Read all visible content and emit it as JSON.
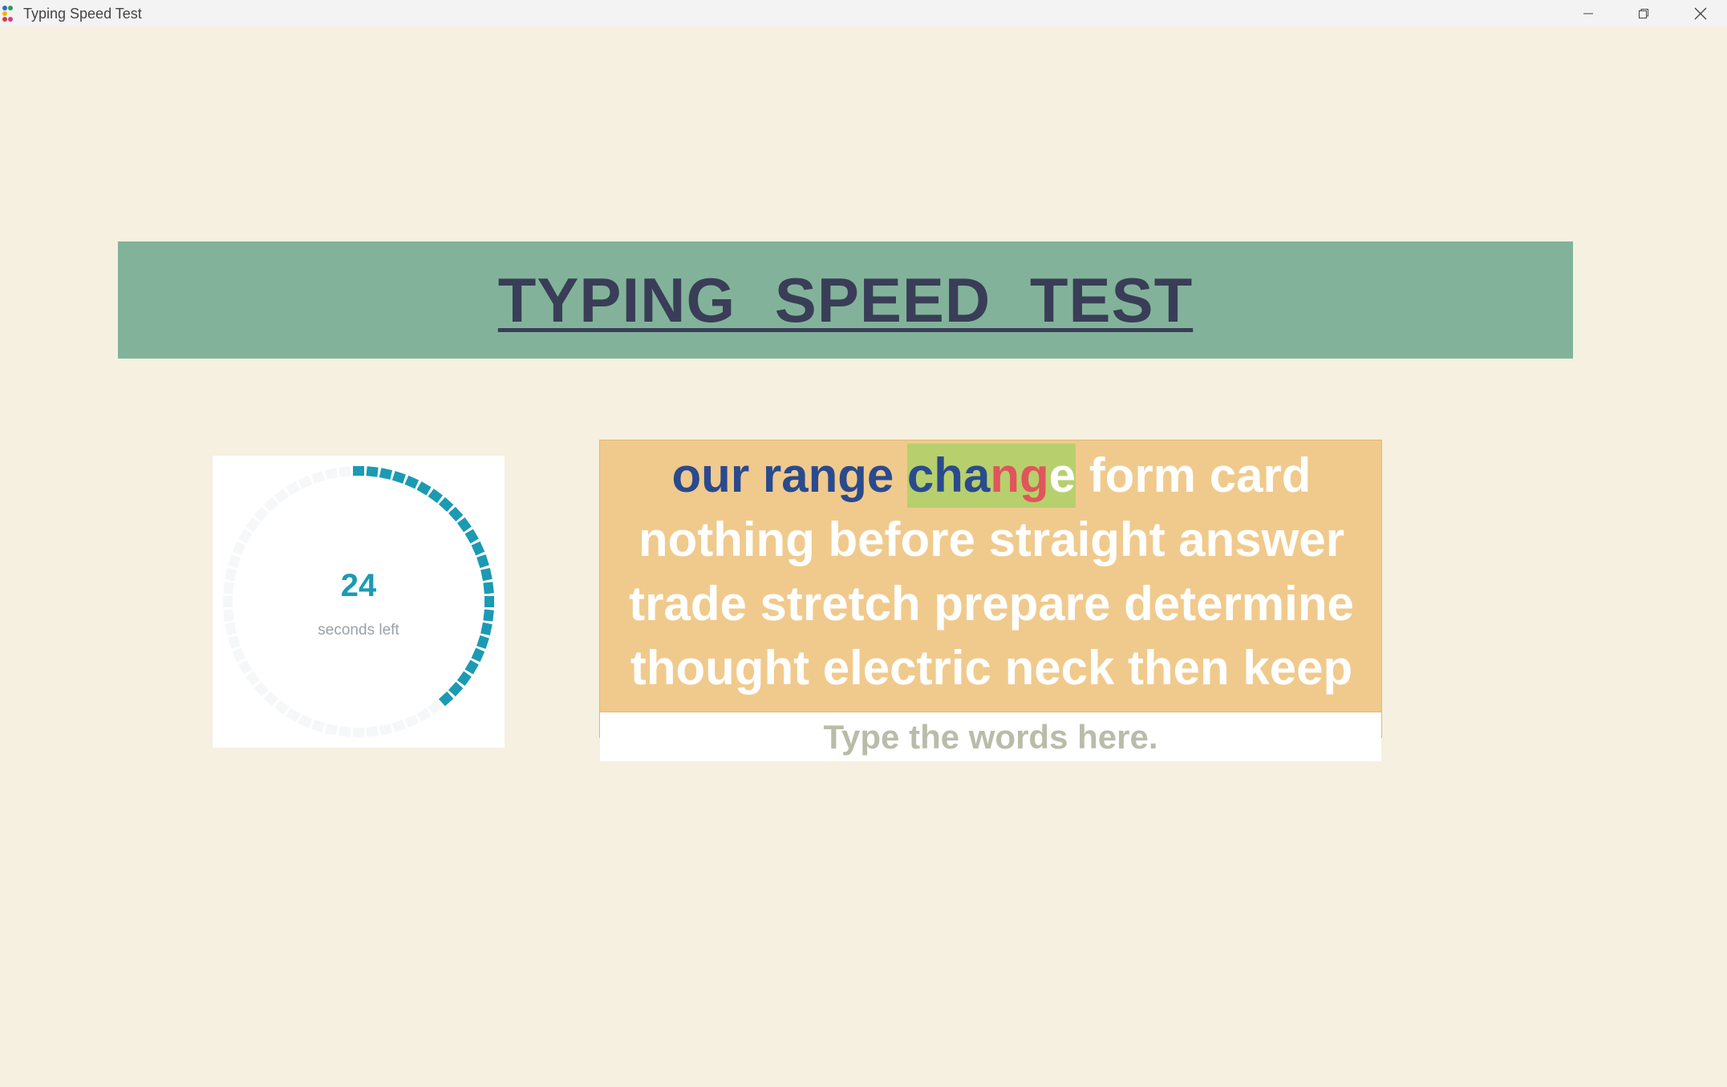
{
  "window": {
    "title": "Typing Speed Test",
    "minimize_icon": "minimize-icon",
    "maximize_icon": "restore-icon",
    "close_icon": "close-icon"
  },
  "banner": {
    "title": "TYPING  SPEED  TEST"
  },
  "timer": {
    "seconds_left": "24",
    "label": "seconds left",
    "total_seconds": 60,
    "remaining_fraction": 0.4,
    "progress_color": "#1B9AB4",
    "track_color": "#F5F7F8"
  },
  "words": {
    "lines": [
      [
        {
          "text": "our",
          "state": "done"
        },
        {
          "text": "range",
          "state": "done"
        },
        {
          "text": "change",
          "state": "current",
          "chars": [
            "ok",
            "ok",
            "ok",
            "bad",
            "bad",
            "todo"
          ]
        },
        {
          "text": "form",
          "state": "todo"
        },
        {
          "text": "card",
          "state": "todo"
        }
      ],
      [
        {
          "text": "nothing",
          "state": "todo"
        },
        {
          "text": "before",
          "state": "todo"
        },
        {
          "text": "straight",
          "state": "todo"
        },
        {
          "text": "answer",
          "state": "todo"
        }
      ],
      [
        {
          "text": "trade",
          "state": "todo"
        },
        {
          "text": "stretch",
          "state": "todo"
        },
        {
          "text": "prepare",
          "state": "todo"
        },
        {
          "text": "determine",
          "state": "todo"
        }
      ],
      [
        {
          "text": "thought",
          "state": "todo"
        },
        {
          "text": "electric",
          "state": "todo"
        },
        {
          "text": "neck",
          "state": "todo"
        },
        {
          "text": "then",
          "state": "todo"
        },
        {
          "text": "keep",
          "state": "todo"
        }
      ]
    ],
    "colors": {
      "done": "#2A4A8E",
      "error": "#E0555B",
      "todo": "#FFFFFF",
      "current_highlight": "#B7D06D",
      "box_bg": "#F0CA8C"
    }
  },
  "input": {
    "value": "",
    "placeholder": "Type the words here."
  }
}
